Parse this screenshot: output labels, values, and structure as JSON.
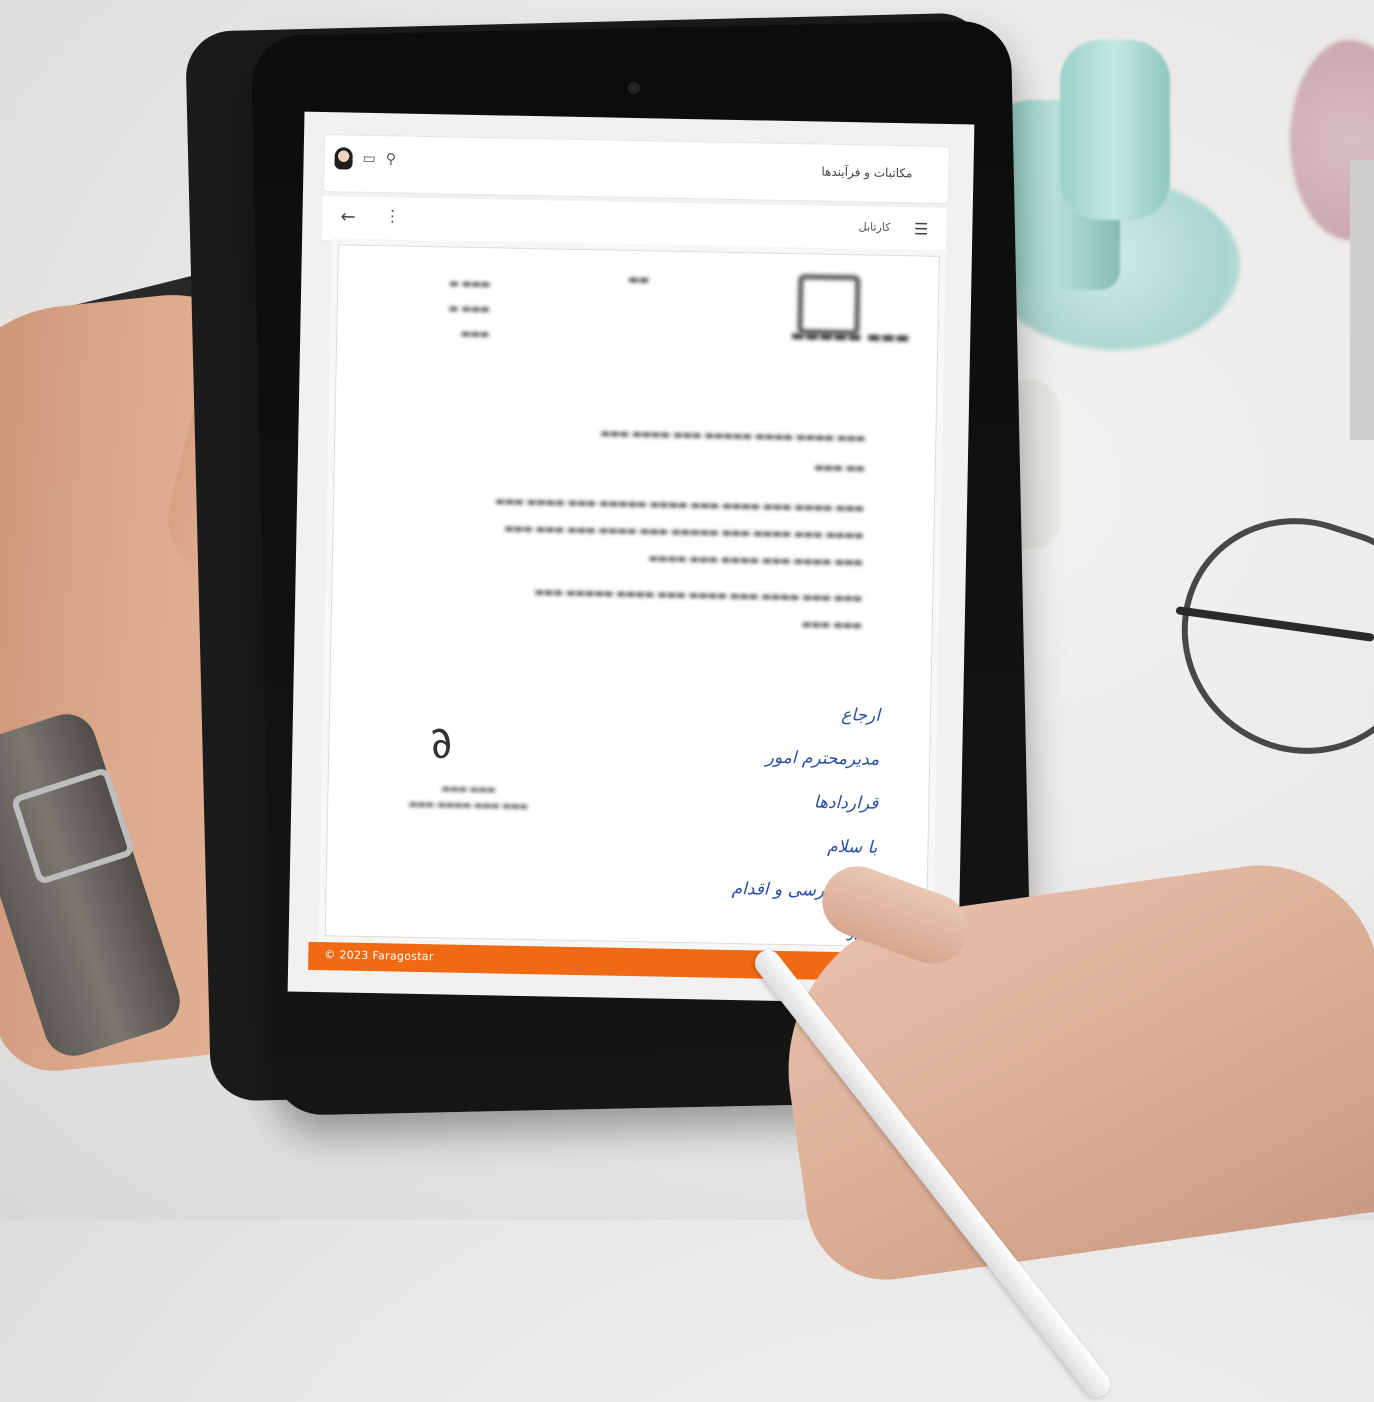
{
  "app": {
    "title": "مکاتبات و فرآیندها",
    "board_label": "کارتابل",
    "footer_text": "© 2023  Faragostar",
    "accent_color": "#f06a14"
  },
  "icons": {
    "avatar": "user-avatar",
    "messages": "chat-icon",
    "search": "search-icon",
    "back": "arrow-left-icon",
    "more": "kebab-icon",
    "menu": "hamburger-icon"
  },
  "letter": {
    "handwritten_note": [
      "ارجاع",
      "مدیرمحترم امور قراردادها",
      "با سلام",
      "لطفاً بررسی و اقدام شود"
    ]
  }
}
